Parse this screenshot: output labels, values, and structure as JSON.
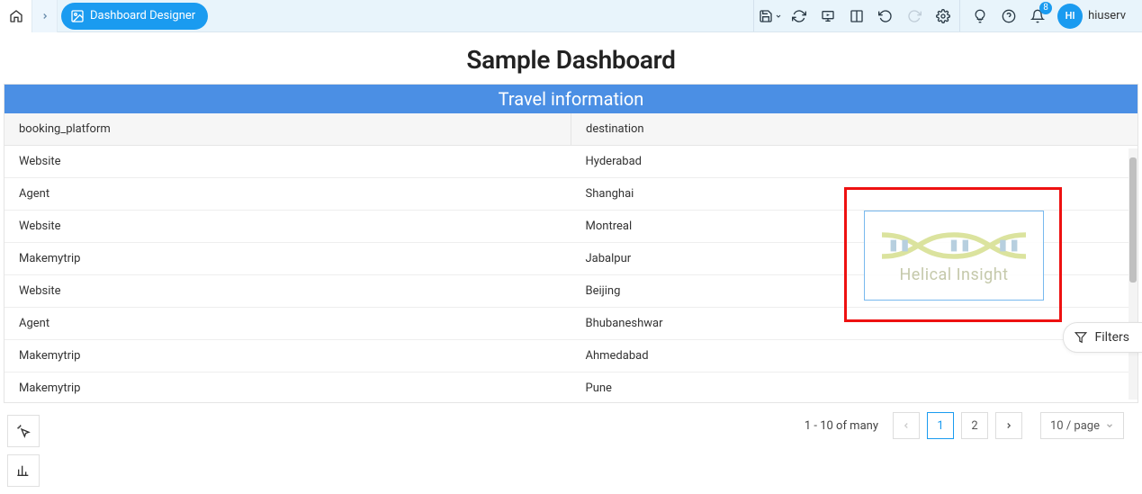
{
  "breadcrumb": {
    "active_label": "Dashboard Designer"
  },
  "user": {
    "avatar_initials": "HI",
    "name": "hiuserv"
  },
  "notifications": {
    "count": "8"
  },
  "dashboard": {
    "title": "Sample Dashboard"
  },
  "panel": {
    "title": "Travel information",
    "columns": {
      "c0": "booking_platform",
      "c1": "destination"
    },
    "rows": [
      {
        "c0": "Website",
        "c1": "Hyderabad"
      },
      {
        "c0": "Agent",
        "c1": "Shanghai"
      },
      {
        "c0": "Website",
        "c1": "Montreal"
      },
      {
        "c0": "Makemytrip",
        "c1": "Jabalpur"
      },
      {
        "c0": "Website",
        "c1": "Beijing"
      },
      {
        "c0": "Agent",
        "c1": "Bhubaneshwar"
      },
      {
        "c0": "Makemytrip",
        "c1": "Ahmedabad"
      },
      {
        "c0": "Makemytrip",
        "c1": "Pune"
      }
    ]
  },
  "logo": {
    "text": "Helical Insight"
  },
  "filters": {
    "label": "Filters"
  },
  "pagination": {
    "info": "1 - 10 of many",
    "pages": {
      "p1": "1",
      "p2": "2"
    },
    "page_size": "10 / page"
  }
}
